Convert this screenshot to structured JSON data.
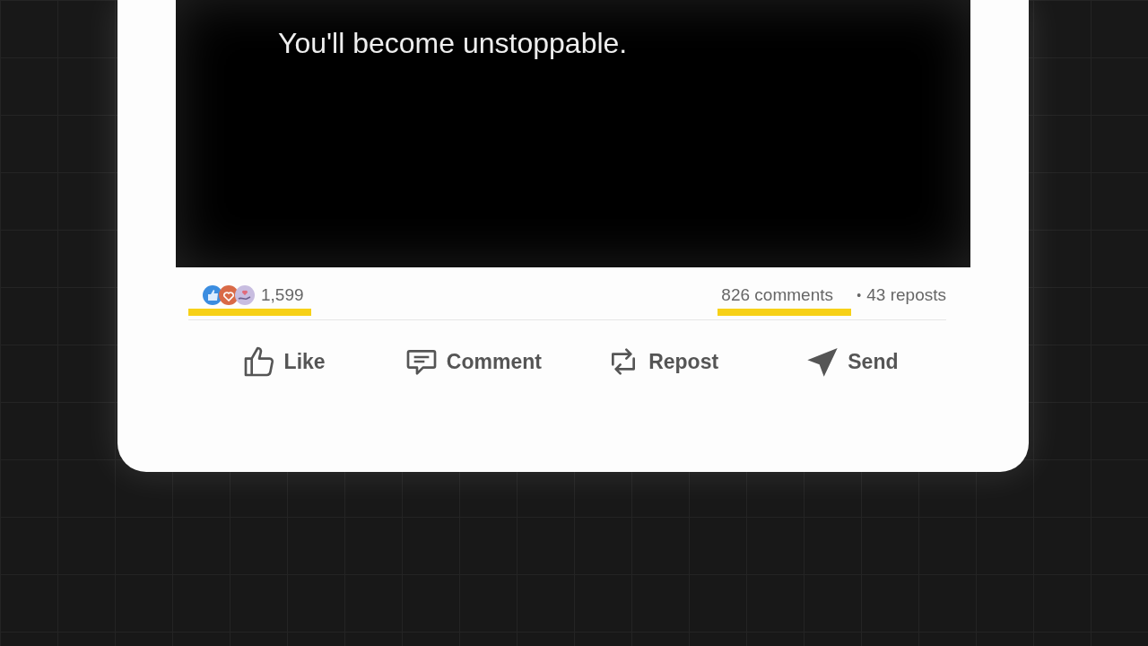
{
  "post": {
    "image_caption": "You'll become unstoppable."
  },
  "stats": {
    "reactions": {
      "count": "1,599",
      "highlighted": true
    },
    "comments": {
      "text": "826 comments",
      "highlighted": true
    },
    "separator": "•",
    "reposts": {
      "text": "43 reposts"
    }
  },
  "actions": [
    {
      "kind": "like",
      "label": "Like"
    },
    {
      "kind": "comment",
      "label": "Comment"
    },
    {
      "kind": "repost",
      "label": "Repost"
    },
    {
      "kind": "send",
      "label": "Send"
    }
  ]
}
